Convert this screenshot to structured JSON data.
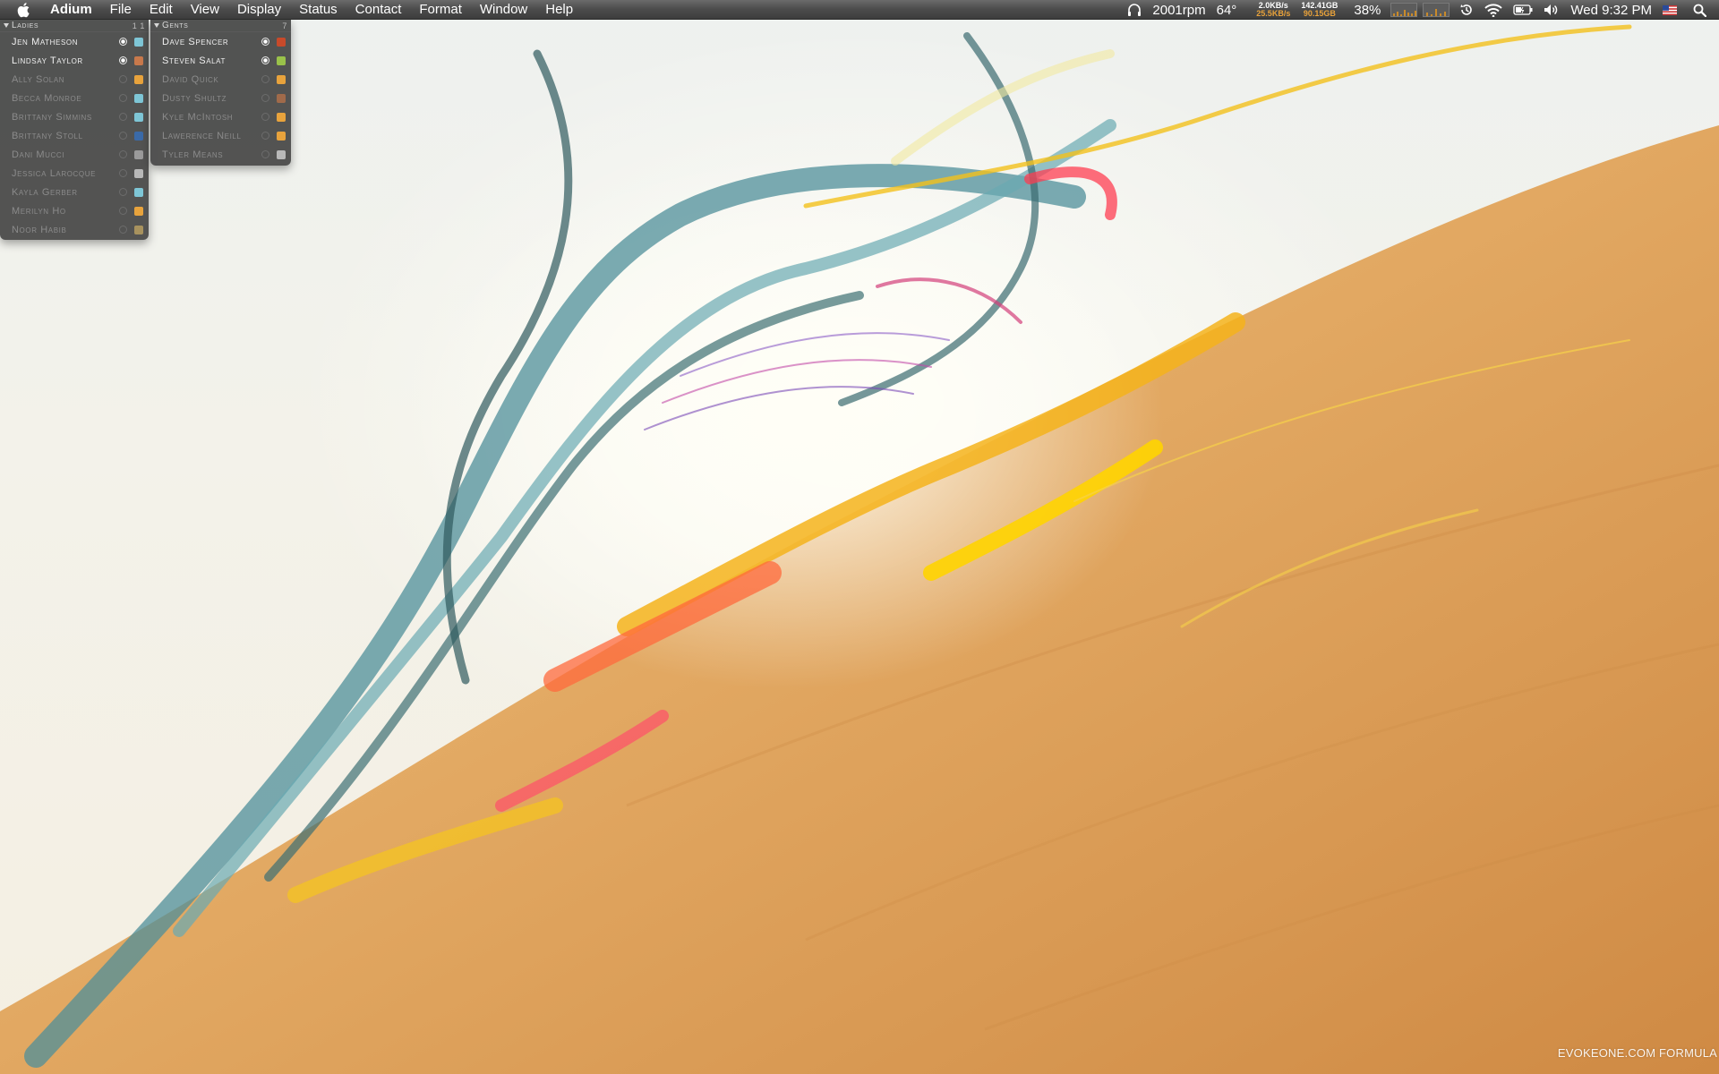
{
  "menubar": {
    "app_name": "Adium",
    "menus": [
      "File",
      "Edit",
      "View",
      "Display",
      "Status",
      "Contact",
      "Format",
      "Window",
      "Help"
    ],
    "fan_speed": "2001rpm",
    "temperature": "64°",
    "network_up": "2.0KB/s",
    "network_down": "25.5KB/s",
    "disk_used": "142.41GB",
    "disk_free": "90.15GB",
    "battery_percent": "38%",
    "clock": "Wed 9:32 PM",
    "icons": {
      "apple": "apple-icon",
      "headphones": "headphones-icon",
      "time_machine": "time-machine-icon",
      "wifi": "wifi-icon",
      "battery": "battery-icon",
      "volume": "volume-icon",
      "input_source": "us-flag-icon",
      "spotlight": "spotlight-search-icon"
    }
  },
  "ladies": {
    "group_name": "Ladies",
    "count": "1 1",
    "contacts": [
      {
        "name": "Jen Matheson",
        "online": true,
        "service_color": "#7ec6d6"
      },
      {
        "name": "Lindsay Taylor",
        "online": true,
        "service_color": "#c8794b"
      },
      {
        "name": "Ally Solan",
        "online": false,
        "service_color": "#e8a33c"
      },
      {
        "name": "Becca Monroe",
        "online": false,
        "service_color": "#7ec6d6"
      },
      {
        "name": "Brittany Simmins",
        "online": false,
        "service_color": "#7ec6d6"
      },
      {
        "name": "Brittany Stoll",
        "online": false,
        "service_color": "#3a6aa8"
      },
      {
        "name": "Dani Mucci",
        "online": false,
        "service_color": "#9a9a9a"
      },
      {
        "name": "Jessica Larocque",
        "online": false,
        "service_color": "#b8b8b8"
      },
      {
        "name": "Kayla Gerber",
        "online": false,
        "service_color": "#7ec6d6"
      },
      {
        "name": "Merilyn Ho",
        "online": false,
        "service_color": "#e8a33c"
      },
      {
        "name": "Noor Habib",
        "online": false,
        "service_color": "#a8925e"
      }
    ]
  },
  "gents": {
    "group_name": "Gents",
    "count": "7",
    "contacts": [
      {
        "name": "Dave Spencer",
        "online": true,
        "service_color": "#c84a2a"
      },
      {
        "name": "Steven Salat",
        "online": true,
        "service_color": "#9ac24a"
      },
      {
        "name": "David Quick",
        "online": false,
        "service_color": "#e8a33c"
      },
      {
        "name": "Dusty Shultz",
        "online": false,
        "service_color": "#a06a4a"
      },
      {
        "name": "Kyle McIntosh",
        "online": false,
        "service_color": "#e8a33c"
      },
      {
        "name": "Lawerence Neill",
        "online": false,
        "service_color": "#e8a33c"
      },
      {
        "name": "Tyler Means",
        "online": false,
        "service_color": "#b8b8b8"
      }
    ]
  },
  "wallpaper": {
    "credit": "EVOKEONE.COM FORMULA"
  }
}
